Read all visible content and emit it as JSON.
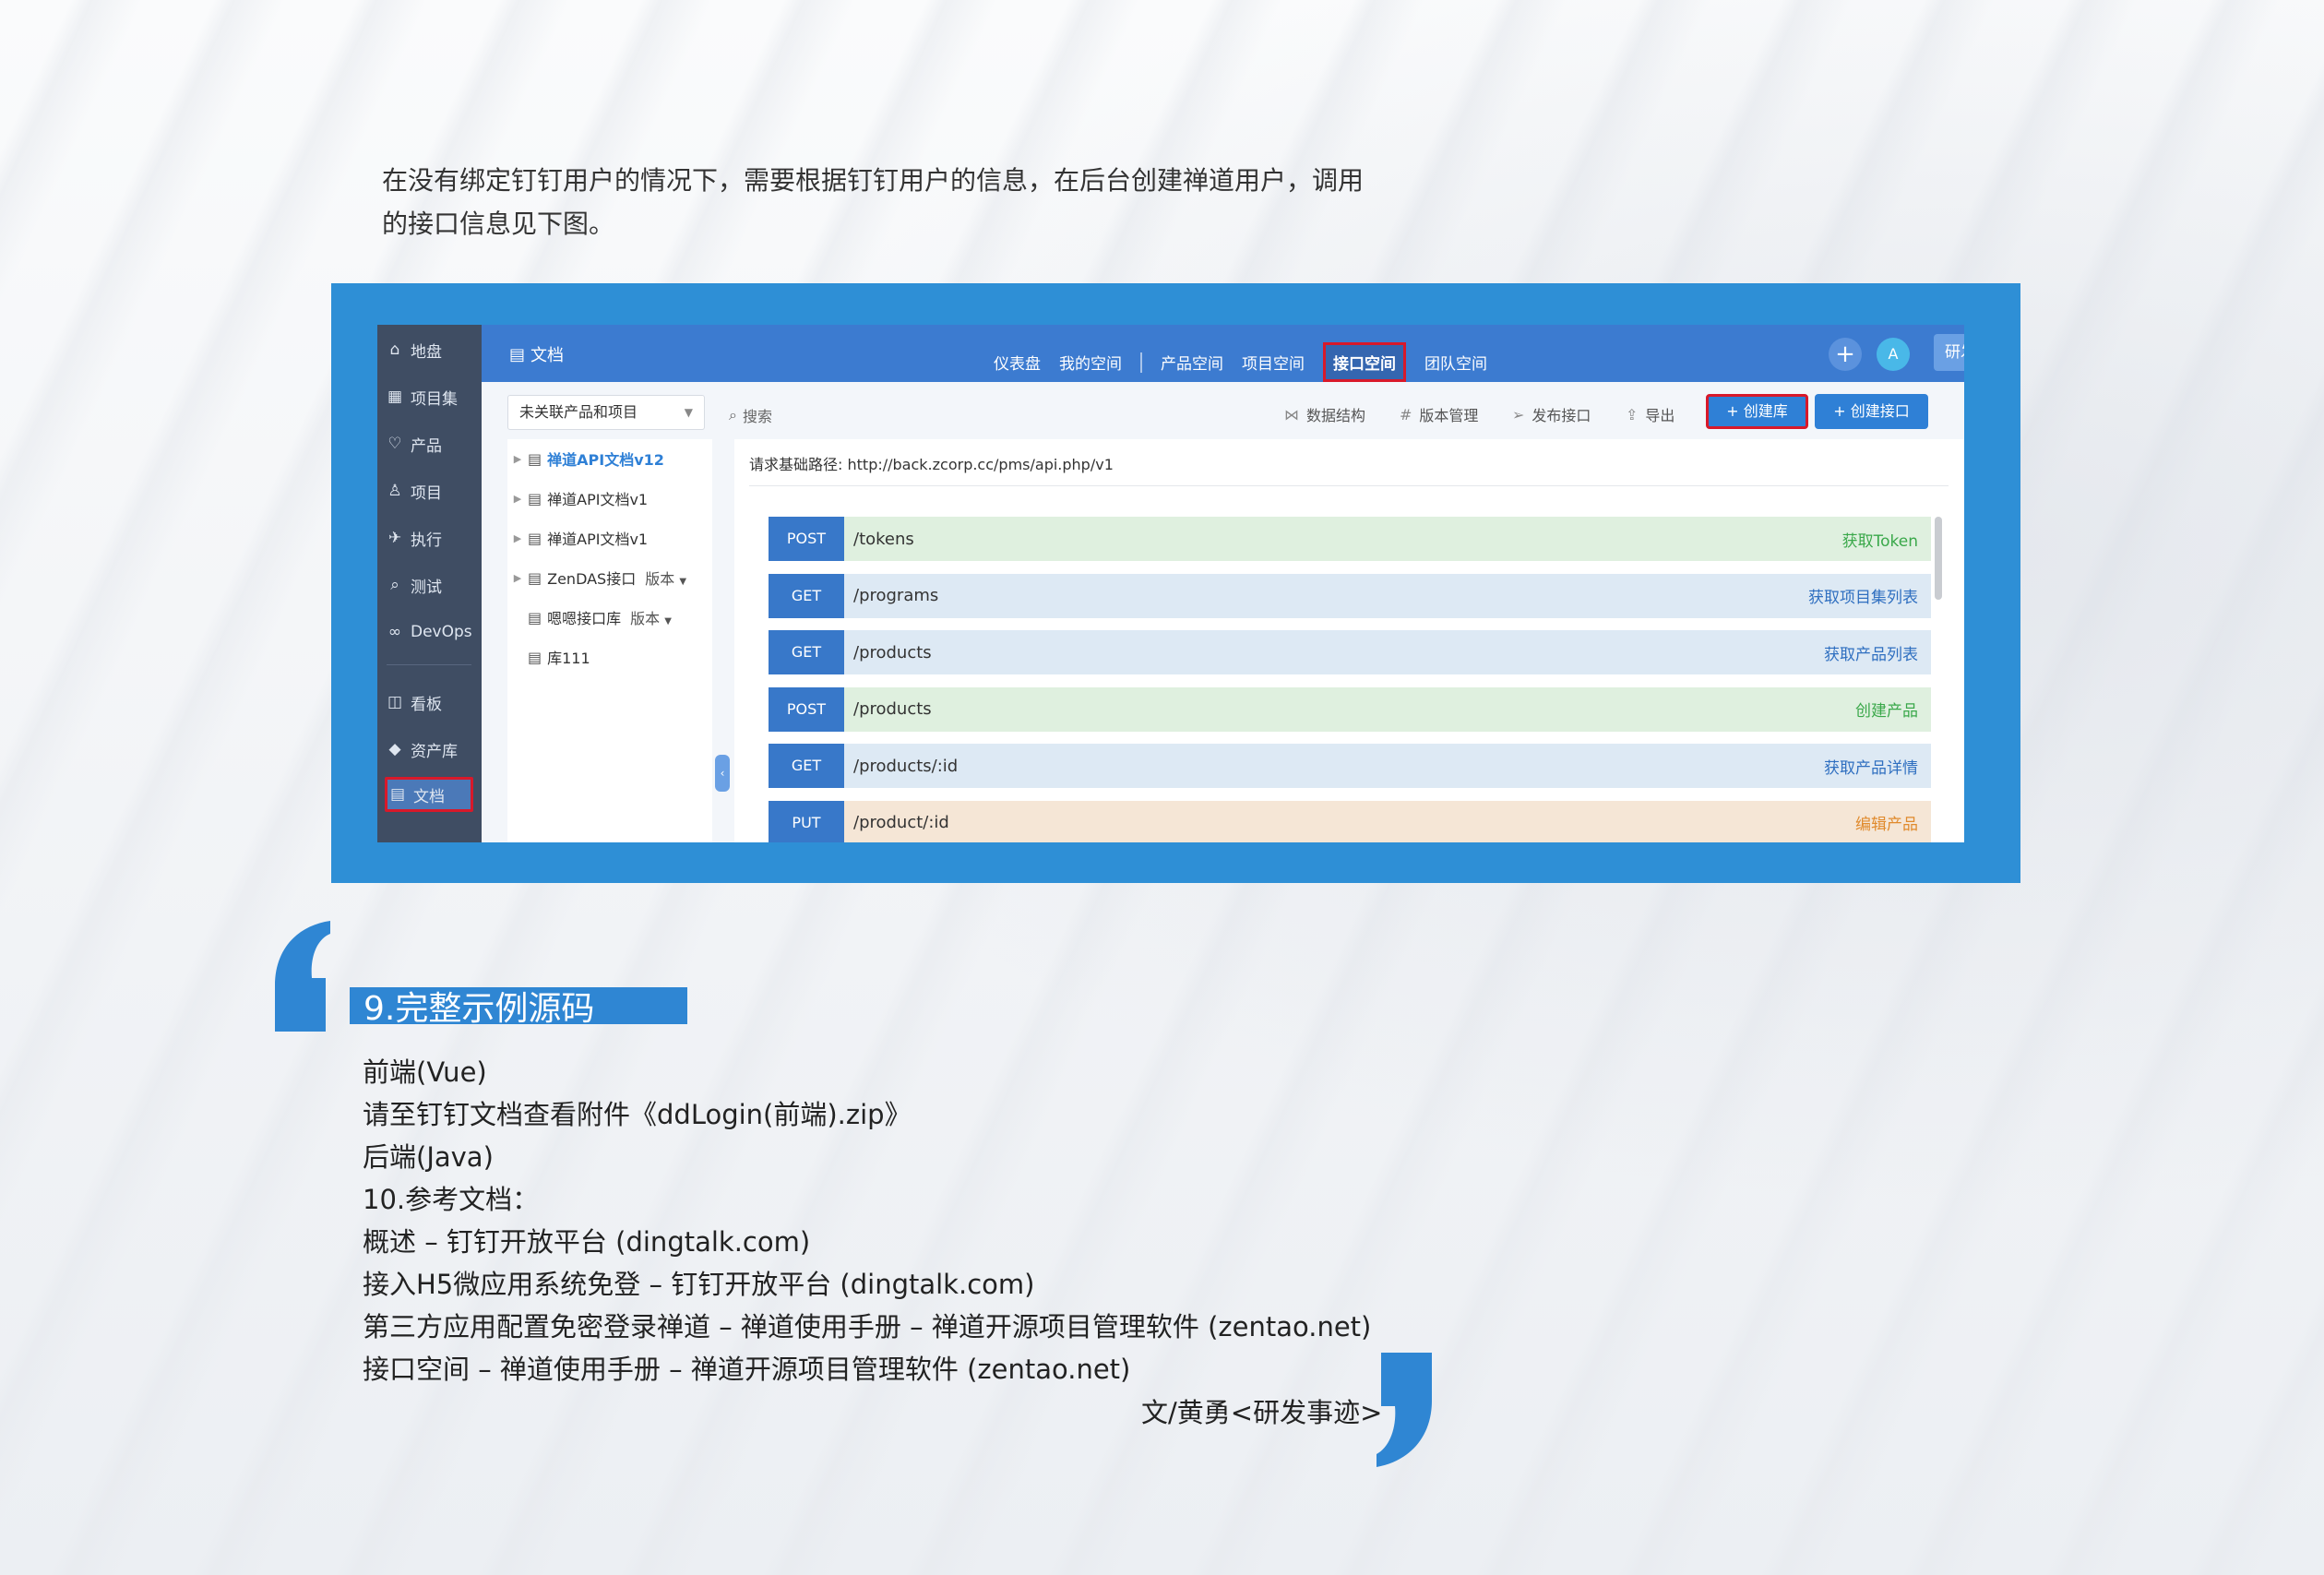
{
  "intro": {
    "line1": "在没有绑定钉钉用户的情况下，需要根据钉钉用户的信息，在后台创建禅道用户，调用",
    "line2": "的接口信息见下图。"
  },
  "screenshot": {
    "sidebar": [
      {
        "icon": "home-icon",
        "label": "地盘"
      },
      {
        "icon": "grid-icon",
        "label": "项目集"
      },
      {
        "icon": "lightbulb-icon",
        "label": "产品"
      },
      {
        "icon": "bell-icon",
        "label": "项目"
      },
      {
        "icon": "run-icon",
        "label": "执行"
      },
      {
        "icon": "search-icon",
        "label": "测试"
      },
      {
        "icon": "infinity-icon",
        "label": "DevOps"
      },
      {
        "icon": "board-icon",
        "label": "看板"
      },
      {
        "icon": "diamond-icon",
        "label": "资产库"
      },
      {
        "icon": "doc-icon",
        "label": "文档"
      }
    ],
    "topbar": {
      "title": "文档",
      "nav": [
        "仪表盘",
        "我的空间",
        "产品空间",
        "项目空间",
        "接口空间",
        "团队空间"
      ],
      "active_nav": "接口空间",
      "plus": "+",
      "avatar": "A",
      "right_button": "研发综合界面"
    },
    "toolbar": {
      "select_value": "未关联产品和项目",
      "search_label": "搜索",
      "tools": [
        {
          "icon": "share-icon",
          "label": "数据结构"
        },
        {
          "icon": "hash-icon",
          "label": "版本管理"
        },
        {
          "icon": "send-icon",
          "label": "发布接口"
        },
        {
          "icon": "export-icon",
          "label": "导出"
        }
      ],
      "create_lib": "+ 创建库",
      "create_api": "+ 创建接口"
    },
    "tree": [
      {
        "label": "禅道API文档v12",
        "selected": true,
        "arrow": true
      },
      {
        "label": "禅道API文档v1",
        "arrow": true
      },
      {
        "label": "禅道API文档v1",
        "arrow": true
      },
      {
        "label": "ZenDAS接口",
        "version": "版本",
        "arrow": true
      },
      {
        "label": "嗯嗯接口库",
        "version": "版本",
        "arrow": false
      },
      {
        "label": "库111",
        "arrow": false
      }
    ],
    "base_url_label": "请求基础路径:",
    "base_url": "http://back.zcorp.cc/pms/api.php/v1",
    "apis": [
      {
        "method": "POST",
        "path": "/tokens",
        "desc": "获取Token",
        "bg": "#dff0df",
        "descColor": "#3aa84a"
      },
      {
        "method": "GET",
        "path": "/programs",
        "desc": "获取项目集列表",
        "bg": "#dde9f4",
        "descColor": "#2f6fc0"
      },
      {
        "method": "GET",
        "path": "/products",
        "desc": "获取产品列表",
        "bg": "#dde9f4",
        "descColor": "#2f6fc0"
      },
      {
        "method": "POST",
        "path": "/products",
        "desc": "创建产品",
        "bg": "#dff0df",
        "descColor": "#3aa84a"
      },
      {
        "method": "GET",
        "path": "/products/:id",
        "desc": "获取产品详情",
        "bg": "#dde9f4",
        "descColor": "#2f6fc0"
      },
      {
        "method": "PUT",
        "path": "/product/:id",
        "desc": "编辑产品",
        "bg": "#f5e6d6",
        "descColor": "#e08a2c"
      }
    ]
  },
  "section": {
    "title": "9.完整示例源码"
  },
  "body": [
    "前端(Vue)",
    "请至钉钉文档查看附件《ddLogin(前端).zip》",
    "后端(Java)",
    "10.参考文档：",
    "概述 – 钉钉开放平台 (dingtalk.com)",
    "接入H5微应用系统免登 – 钉钉开放平台 (dingtalk.com)",
    "第三方应用配置免密登录禅道 – 禅道使用手册 – 禅道开源项目管理软件 (zentao.net)",
    "接口空间 – 禅道使用手册 – 禅道开源项目管理软件 (zentao.net)"
  ],
  "author": "文/黄勇<研发事迹>",
  "colors": {
    "accent": "#2f86d3",
    "highlight": "#d8192a"
  }
}
